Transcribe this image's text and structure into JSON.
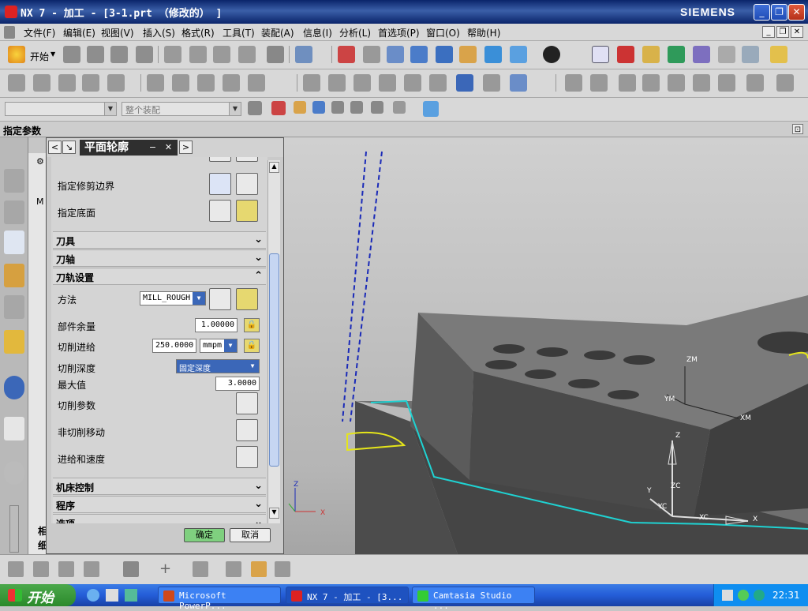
{
  "window": {
    "title": "NX 7 - 加工 - [3-1.prt （修改的） ]",
    "brand": "SIEMENS"
  },
  "menu": [
    "文件(F)",
    "编辑(E)",
    "视图(V)",
    "插入(S)",
    "格式(R)",
    "工具(T)",
    "装配(A)",
    "信息(I)",
    "分析(L)",
    "首选项(P)",
    "窗口(O)",
    "帮助(H)"
  ],
  "toolbar": {
    "start_label": "开始",
    "filter_placeholder": "",
    "assembly_scope": "整个装配"
  },
  "cue_line": "指定参数",
  "dialog": {
    "title": "平面轮廓",
    "rows": {
      "trim_boundary": "指定修剪边界",
      "floor": "指定底面"
    },
    "sections": {
      "tool": "刀具",
      "tool_axis": "刀轴",
      "path_settings": "刀轨设置",
      "machine_control": "机床控制",
      "program": "程序",
      "options": "选项"
    },
    "fields": {
      "method_label": "方法",
      "method_value": "MILL_ROUGH",
      "stock_label": "部件余量",
      "stock_value": "1.00000",
      "feed_label": "切削进给",
      "feed_value": "250.0000",
      "feed_unit": "mmpm",
      "depth_label": "切削深度",
      "depth_value": "固定深度",
      "max_label": "最大值",
      "max_value": "3.0000",
      "cut_params_label": "切削参数",
      "noncut_label": "非切削移动",
      "feeds_label": "进给和速度"
    },
    "ok": "确定",
    "cancel": "取消"
  },
  "navigator": {
    "tab_m": "M",
    "section_a": "相",
    "section_b": "细"
  },
  "viewport": {
    "wcs_labels": {
      "zm": "ZM",
      "ym": "YM",
      "xm": "XM"
    },
    "abs_labels": {
      "z": "Z",
      "y": "Y",
      "x": "X",
      "zc": "ZC",
      "yc": "YC",
      "xc": "XC"
    },
    "mini_axes": {
      "z": "Z",
      "x": "X"
    }
  },
  "taskbar": {
    "start": "开始",
    "tasks": [
      "Microsoft PowerP...",
      "NX 7 - 加工 - [3...",
      "Camtasia Studio ..."
    ],
    "clock": "22:31"
  }
}
